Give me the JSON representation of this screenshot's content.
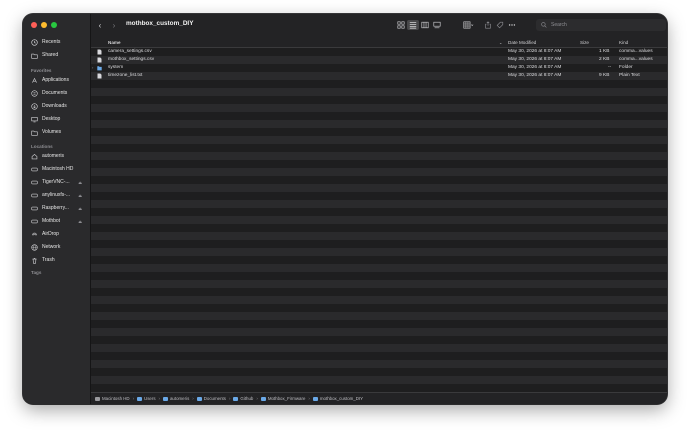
{
  "window": {
    "title": "mothbox_custom_DIY"
  },
  "sidebar": {
    "top_items": [
      {
        "label": "Recents",
        "icon": "clock-icon"
      },
      {
        "label": "Shared",
        "icon": "shared-folder-icon"
      }
    ],
    "favorites_label": "Favorites",
    "favorites": [
      {
        "label": "Applications",
        "icon": "applications-icon"
      },
      {
        "label": "Documents",
        "icon": "document-icon"
      },
      {
        "label": "Downloads",
        "icon": "download-icon"
      },
      {
        "label": "Desktop",
        "icon": "desktop-icon"
      },
      {
        "label": "Volumes",
        "icon": "folder-icon"
      }
    ],
    "locations_label": "Locations",
    "locations": [
      {
        "label": "automeris",
        "icon": "home-icon"
      },
      {
        "label": "Macintosh HD",
        "icon": "drive-icon"
      },
      {
        "label": "TigerVNC-...",
        "icon": "drive-icon",
        "eject": true
      },
      {
        "label": "anylinuxfs-...",
        "icon": "drive-icon",
        "eject": true
      },
      {
        "label": "Raspberry...",
        "icon": "drive-icon",
        "eject": true
      },
      {
        "label": "Mothbot",
        "icon": "drive-icon",
        "eject": true
      },
      {
        "label": "AirDrop",
        "icon": "airdrop-icon"
      },
      {
        "label": "Network",
        "icon": "network-icon"
      },
      {
        "label": "Trash",
        "icon": "trash-icon"
      }
    ],
    "tags_label": "Tags"
  },
  "toolbar": {
    "back_glyph": "‹",
    "forward_glyph": "›",
    "search_placeholder": "Search"
  },
  "columns": {
    "name": "Name",
    "date": "Date Modified",
    "size": "Size",
    "kind": "Kind"
  },
  "files": [
    {
      "name": "camera_settings.csv",
      "date": "May 30, 2026 at 8:07 AM",
      "size": "1 KB",
      "kind": "comma...values",
      "type": "file"
    },
    {
      "name": "mothbox_settings.csv",
      "date": "May 30, 2026 at 8:07 AM",
      "size": "2 KB",
      "kind": "comma...values",
      "type": "file"
    },
    {
      "name": "system",
      "date": "May 30, 2026 at 8:07 AM",
      "size": "--",
      "kind": "Folder",
      "type": "folder"
    },
    {
      "name": "timezone_list.txt",
      "date": "May 30, 2026 at 8:07 AM",
      "size": "9 KB",
      "kind": "Plain Text",
      "type": "file"
    }
  ],
  "pathbar": [
    "Macintosh HD",
    "Users",
    "automeris",
    "Documents",
    "Github",
    "Mothbox_Firmware",
    "mothbox_custom_DIY"
  ]
}
